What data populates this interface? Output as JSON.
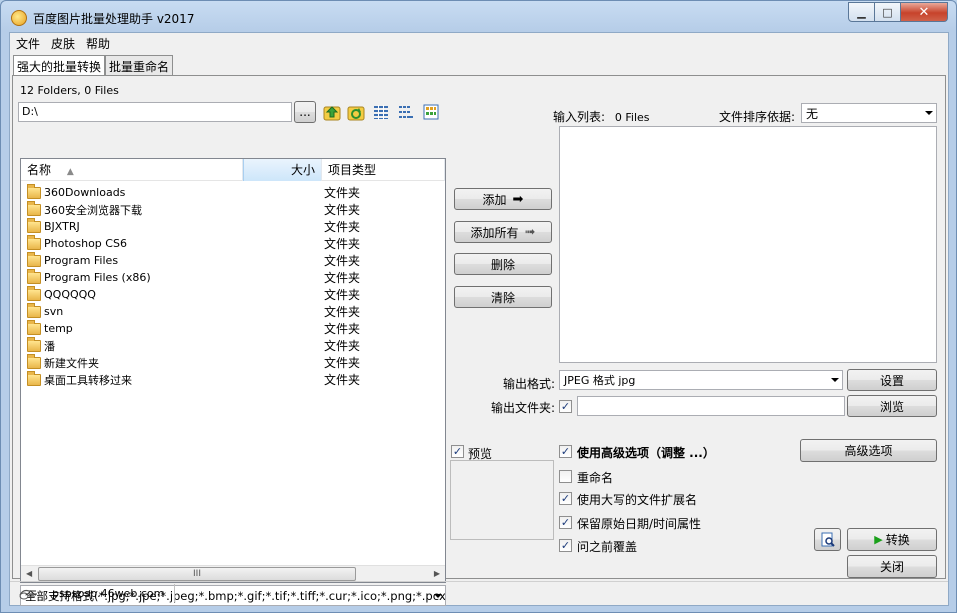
{
  "window": {
    "title": "百度图片批量处理助手  v2017",
    "min": "▁",
    "max": "□",
    "close": "✕"
  },
  "menu": [
    "文件",
    "皮肤",
    "帮助"
  ],
  "tabs": [
    "强大的批量转换",
    "批量重命名"
  ],
  "folder_count": "12 Folders, 0 Files",
  "path": {
    "value": "D:\\",
    "browse": "..."
  },
  "columns": {
    "name": "名称",
    "size": "大小",
    "type": "项目类型"
  },
  "files": [
    {
      "name": "360Downloads",
      "type": "文件夹"
    },
    {
      "name": "360安全浏览器下载",
      "type": "文件夹"
    },
    {
      "name": "BJXTRJ",
      "type": "文件夹"
    },
    {
      "name": "Photoshop CS6",
      "type": "文件夹"
    },
    {
      "name": "Program Files",
      "type": "文件夹"
    },
    {
      "name": "Program Files (x86)",
      "type": "文件夹"
    },
    {
      "name": "QQQQQQ",
      "type": "文件夹"
    },
    {
      "name": "svn",
      "type": "文件夹"
    },
    {
      "name": "temp",
      "type": "文件夹"
    },
    {
      "name": "潘",
      "type": "文件夹"
    },
    {
      "name": "新建文件夹",
      "type": "文件夹"
    },
    {
      "name": "桌面工具转移过来",
      "type": "文件夹"
    }
  ],
  "scroll_thumb": "III",
  "filter": "全部支持格式(*.jpg;*.jpe;*.jpeg;*.bmp;*.gif;*.tif;*.tiff;*.cur;*.ico;*.png;*.pcx;*",
  "buttons": {
    "add": "添加",
    "add_all": "添加所有",
    "delete": "删除",
    "clear": "清除",
    "settings": "设置",
    "browse": "浏览",
    "advanced": "高级选项",
    "convert": "转换",
    "close": "关闭"
  },
  "input_list": {
    "label": "输入列表:",
    "count": "0 Files",
    "sort_label": "文件排序依据:",
    "sort_value": "无"
  },
  "output": {
    "format_label": "输出格式:",
    "format_value": "JPEG 格式 jpg",
    "folder_label": "输出文件夹:",
    "folder_value": ""
  },
  "options": {
    "preview": "预览",
    "advanced": "使用高级选项（调整 ...）",
    "rename": "重命名",
    "uppercase_ext": "使用大写的文件扩展名",
    "keep_date": "保留原始日期/时间属性",
    "overwrite": "问之前覆盖"
  },
  "status": {
    "url": "pspspsp.46web.com"
  },
  "colors": {
    "accent": "#b9d1ea",
    "close": "#c7432b"
  }
}
